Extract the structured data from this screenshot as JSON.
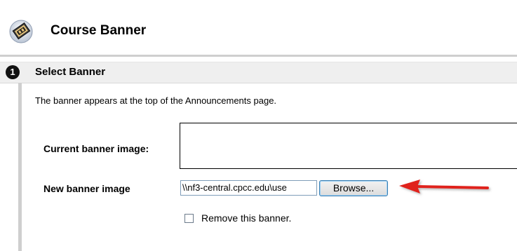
{
  "header": {
    "title": "Course Banner",
    "icon": "course-banner-icon"
  },
  "step": {
    "number": "1",
    "title": "Select Banner",
    "instructions": "The banner appears at the top of the Announcements page."
  },
  "form": {
    "current_banner_label": "Current banner image:",
    "new_banner_label": "New banner image",
    "file_path_value": "\\\\nf3-central.cpcc.edu\\use",
    "browse_label": "Browse...",
    "remove_label": "Remove this banner.",
    "remove_checked": false
  },
  "colors": {
    "accent_arrow": "#e0201b",
    "step_bar_bg": "#efefef",
    "rule": "#cfcfcf"
  }
}
